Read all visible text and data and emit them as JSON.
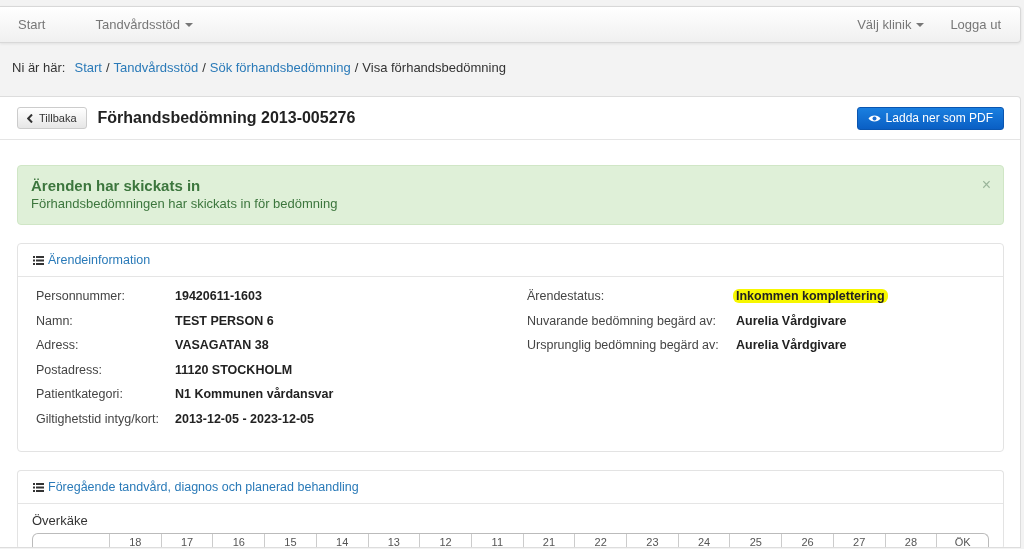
{
  "navbar": {
    "left": [
      {
        "label": "Start",
        "dropdown": false
      },
      {
        "label": "Tandvårdsstöd",
        "dropdown": true
      }
    ],
    "right": [
      {
        "label": "Välj klinik",
        "dropdown": true
      },
      {
        "label": "Logga ut",
        "dropdown": false
      }
    ]
  },
  "breadcrumb": {
    "prefix": "Ni är här:",
    "separator": "/",
    "items": [
      {
        "label": "Start",
        "link": true
      },
      {
        "label": "Tandvårdsstöd",
        "link": true
      },
      {
        "label": "Sök förhandsbedömning",
        "link": true
      },
      {
        "label": "Visa förhandsbedömning",
        "link": false
      }
    ]
  },
  "header": {
    "back_button": "Tillbaka",
    "title": "Förhandsbedömning 2013-005276",
    "pdf_button": "Ladda ner som PDF"
  },
  "alert": {
    "title": "Ärenden har skickats in",
    "message": "Förhandsbedömningen har skickats in för bedömning",
    "close": "×"
  },
  "info_panel": {
    "title": "Ärendeinformation",
    "left": [
      {
        "label": "Personnummer:",
        "value": "19420611-1603",
        "highlighted": false
      },
      {
        "label": "Namn:",
        "value": "TEST PERSON 6",
        "highlighted": false
      },
      {
        "label": "Adress:",
        "value": "VASAGATAN 38",
        "highlighted": false
      },
      {
        "label": "Postadress:",
        "value": "11120 STOCKHOLM",
        "highlighted": false
      },
      {
        "label": "Patientkategori:",
        "value": "N1 Kommunen vårdansvar",
        "highlighted": false
      },
      {
        "label": "Giltighetstid intyg/kort:",
        "value": "2013-12-05 - 2023-12-05",
        "highlighted": false
      }
    ],
    "right": [
      {
        "label": "Ärendestatus:",
        "value": "Inkommen komplettering",
        "highlighted": true
      },
      {
        "label": "Nuvarande bedömning begärd av:",
        "value": "Aurelia Vårdgivare",
        "highlighted": false
      },
      {
        "label": "Ursprunglig bedömning begärd av:",
        "value": "Aurelia Vårdgivare",
        "highlighted": false
      }
    ]
  },
  "treatment_panel": {
    "title": "Föregående tandvård, diagnos och planerad behandling",
    "jaw": "Överkäke",
    "columns": [
      "18",
      "17",
      "16",
      "15",
      "14",
      "13",
      "12",
      "11",
      "21",
      "22",
      "23",
      "24",
      "25",
      "26",
      "27",
      "28",
      "ÖK"
    ]
  }
}
